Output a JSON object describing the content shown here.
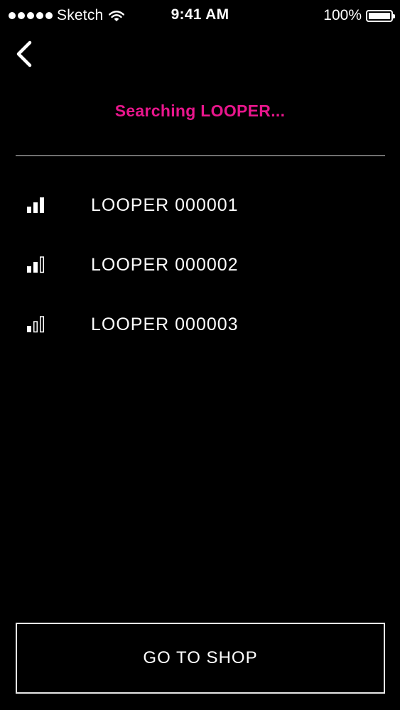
{
  "statusbar": {
    "carrier": "Sketch",
    "time": "9:41 AM",
    "battery": "100%",
    "signal_dots": 5
  },
  "nav": {
    "back_icon": "chevron-left-icon"
  },
  "title": "Searching LOOPER...",
  "colors": {
    "accent": "#e8168c",
    "background": "#000000",
    "text": "#ffffff",
    "divider": "#d8d8d8"
  },
  "devices": [
    {
      "name": "LOOPER 000001",
      "signal_bars": 3,
      "signal_max": 3,
      "icon": "signal-strength-icon"
    },
    {
      "name": "LOOPER 000002",
      "signal_bars": 2,
      "signal_max": 3,
      "icon": "signal-strength-icon"
    },
    {
      "name": "LOOPER 000003",
      "signal_bars": 1,
      "signal_max": 3,
      "icon": "signal-strength-icon"
    }
  ],
  "shop_button": {
    "label": "GO TO SHOP"
  }
}
